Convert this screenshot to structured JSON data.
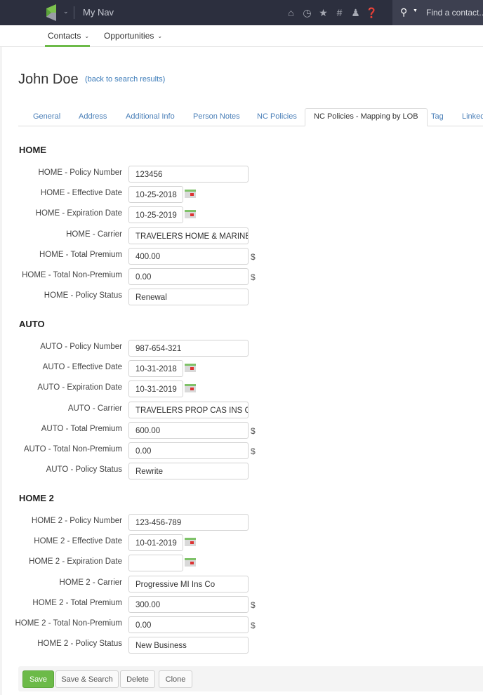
{
  "topbar": {
    "nav_name": "My Nav",
    "icons": [
      "home-icon",
      "history-icon",
      "star-icon",
      "hashtag-icon",
      "user-icon",
      "help-icon"
    ],
    "search_placeholder": "Find a contact..."
  },
  "subnav": {
    "items": [
      {
        "label": "Contacts",
        "active": true
      },
      {
        "label": "Opportunities",
        "active": false
      }
    ]
  },
  "header": {
    "title": "John Doe",
    "back_link": "(back to search results)"
  },
  "tabs": [
    {
      "label": "General"
    },
    {
      "label": "Address"
    },
    {
      "label": "Additional Info"
    },
    {
      "label": "Person Notes"
    },
    {
      "label": "NC Policies"
    },
    {
      "label": "NC Policies - Mapping by LOB",
      "active": true
    },
    {
      "label": "Tag"
    },
    {
      "label": "Linked"
    }
  ],
  "sections": [
    {
      "title": "HOME",
      "fields": [
        {
          "label": "HOME - Policy Number",
          "value": "123456"
        },
        {
          "label": "HOME - Effective Date",
          "value": "10-25-2018"
        },
        {
          "label": "HOME - Expiration Date",
          "value": "10-25-2019"
        },
        {
          "label": "HOME - Carrier",
          "value": "TRAVELERS HOME & MARINE"
        },
        {
          "label": "HOME - Total Premium",
          "value": "400.00",
          "suffix": "$"
        },
        {
          "label": "HOME - Total Non-Premium",
          "value": "0.00",
          "suffix": "$"
        },
        {
          "label": "HOME - Policy Status",
          "value": "Renewal"
        }
      ]
    },
    {
      "title": "AUTO",
      "fields": [
        {
          "label": "AUTO - Policy Number",
          "value": "987-654-321"
        },
        {
          "label": "AUTO - Effective Date",
          "value": "10-31-2018"
        },
        {
          "label": "AUTO - Expiration Date",
          "value": "10-31-2019"
        },
        {
          "label": "AUTO - Carrier",
          "value": "TRAVELERS PROP CAS INS CO"
        },
        {
          "label": "AUTO - Total Premium",
          "value": "600.00",
          "suffix": "$"
        },
        {
          "label": "AUTO - Total Non-Premium",
          "value": "0.00",
          "suffix": "$"
        },
        {
          "label": "AUTO - Policy Status",
          "value": "Rewrite"
        }
      ]
    },
    {
      "title": "HOME 2",
      "fields": [
        {
          "label": "HOME 2 - Policy Number",
          "value": "123-456-789"
        },
        {
          "label": "HOME 2 - Effective Date",
          "value": "10-01-2019"
        },
        {
          "label": "HOME 2 - Expiration Date",
          "value": ""
        },
        {
          "label": "HOME 2 - Carrier",
          "value": "Progressive MI Ins Co"
        },
        {
          "label": "HOME 2 - Total Premium",
          "value": "300.00",
          "suffix": "$"
        },
        {
          "label": "HOME 2 - Total Non-Premium",
          "value": "0.00",
          "suffix": "$"
        },
        {
          "label": "HOME 2 - Policy Status",
          "value": "New Business"
        }
      ]
    }
  ],
  "footer": {
    "save": "Save",
    "save_search": "Save & Search",
    "delete": "Delete",
    "clone": "Clone"
  },
  "colors": {
    "accent_green": "#6cba48",
    "topbar_bg": "#2c2f3e",
    "link_blue": "#4a7fb8"
  }
}
